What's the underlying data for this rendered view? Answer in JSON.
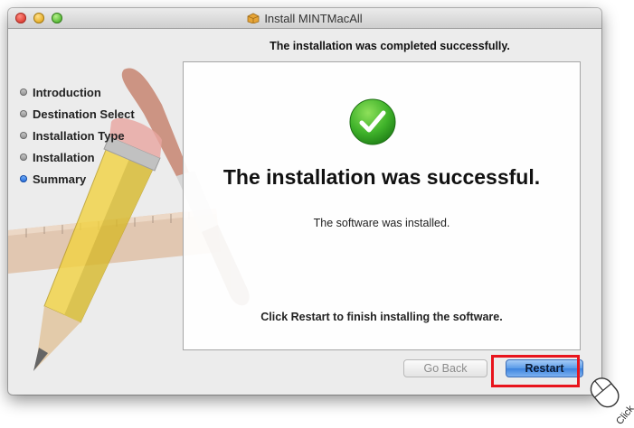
{
  "window": {
    "title": "Install MINTMacAll",
    "heading": "The installation was completed successfully."
  },
  "sidebar": {
    "steps": [
      {
        "label": "Introduction",
        "active": false
      },
      {
        "label": "Destination Select",
        "active": false
      },
      {
        "label": "Installation Type",
        "active": false
      },
      {
        "label": "Installation",
        "active": false
      },
      {
        "label": "Summary",
        "active": true
      }
    ]
  },
  "content": {
    "icon": "green-checkmark-icon",
    "title": "The installation was successful.",
    "subtitle": "The software was installed.",
    "hint": "Click Restart to finish installing the software."
  },
  "buttons": {
    "go_back": "Go Back",
    "restart": "Restart"
  },
  "annotation": {
    "click_label": "Click",
    "highlight_color": "#e8141c"
  }
}
